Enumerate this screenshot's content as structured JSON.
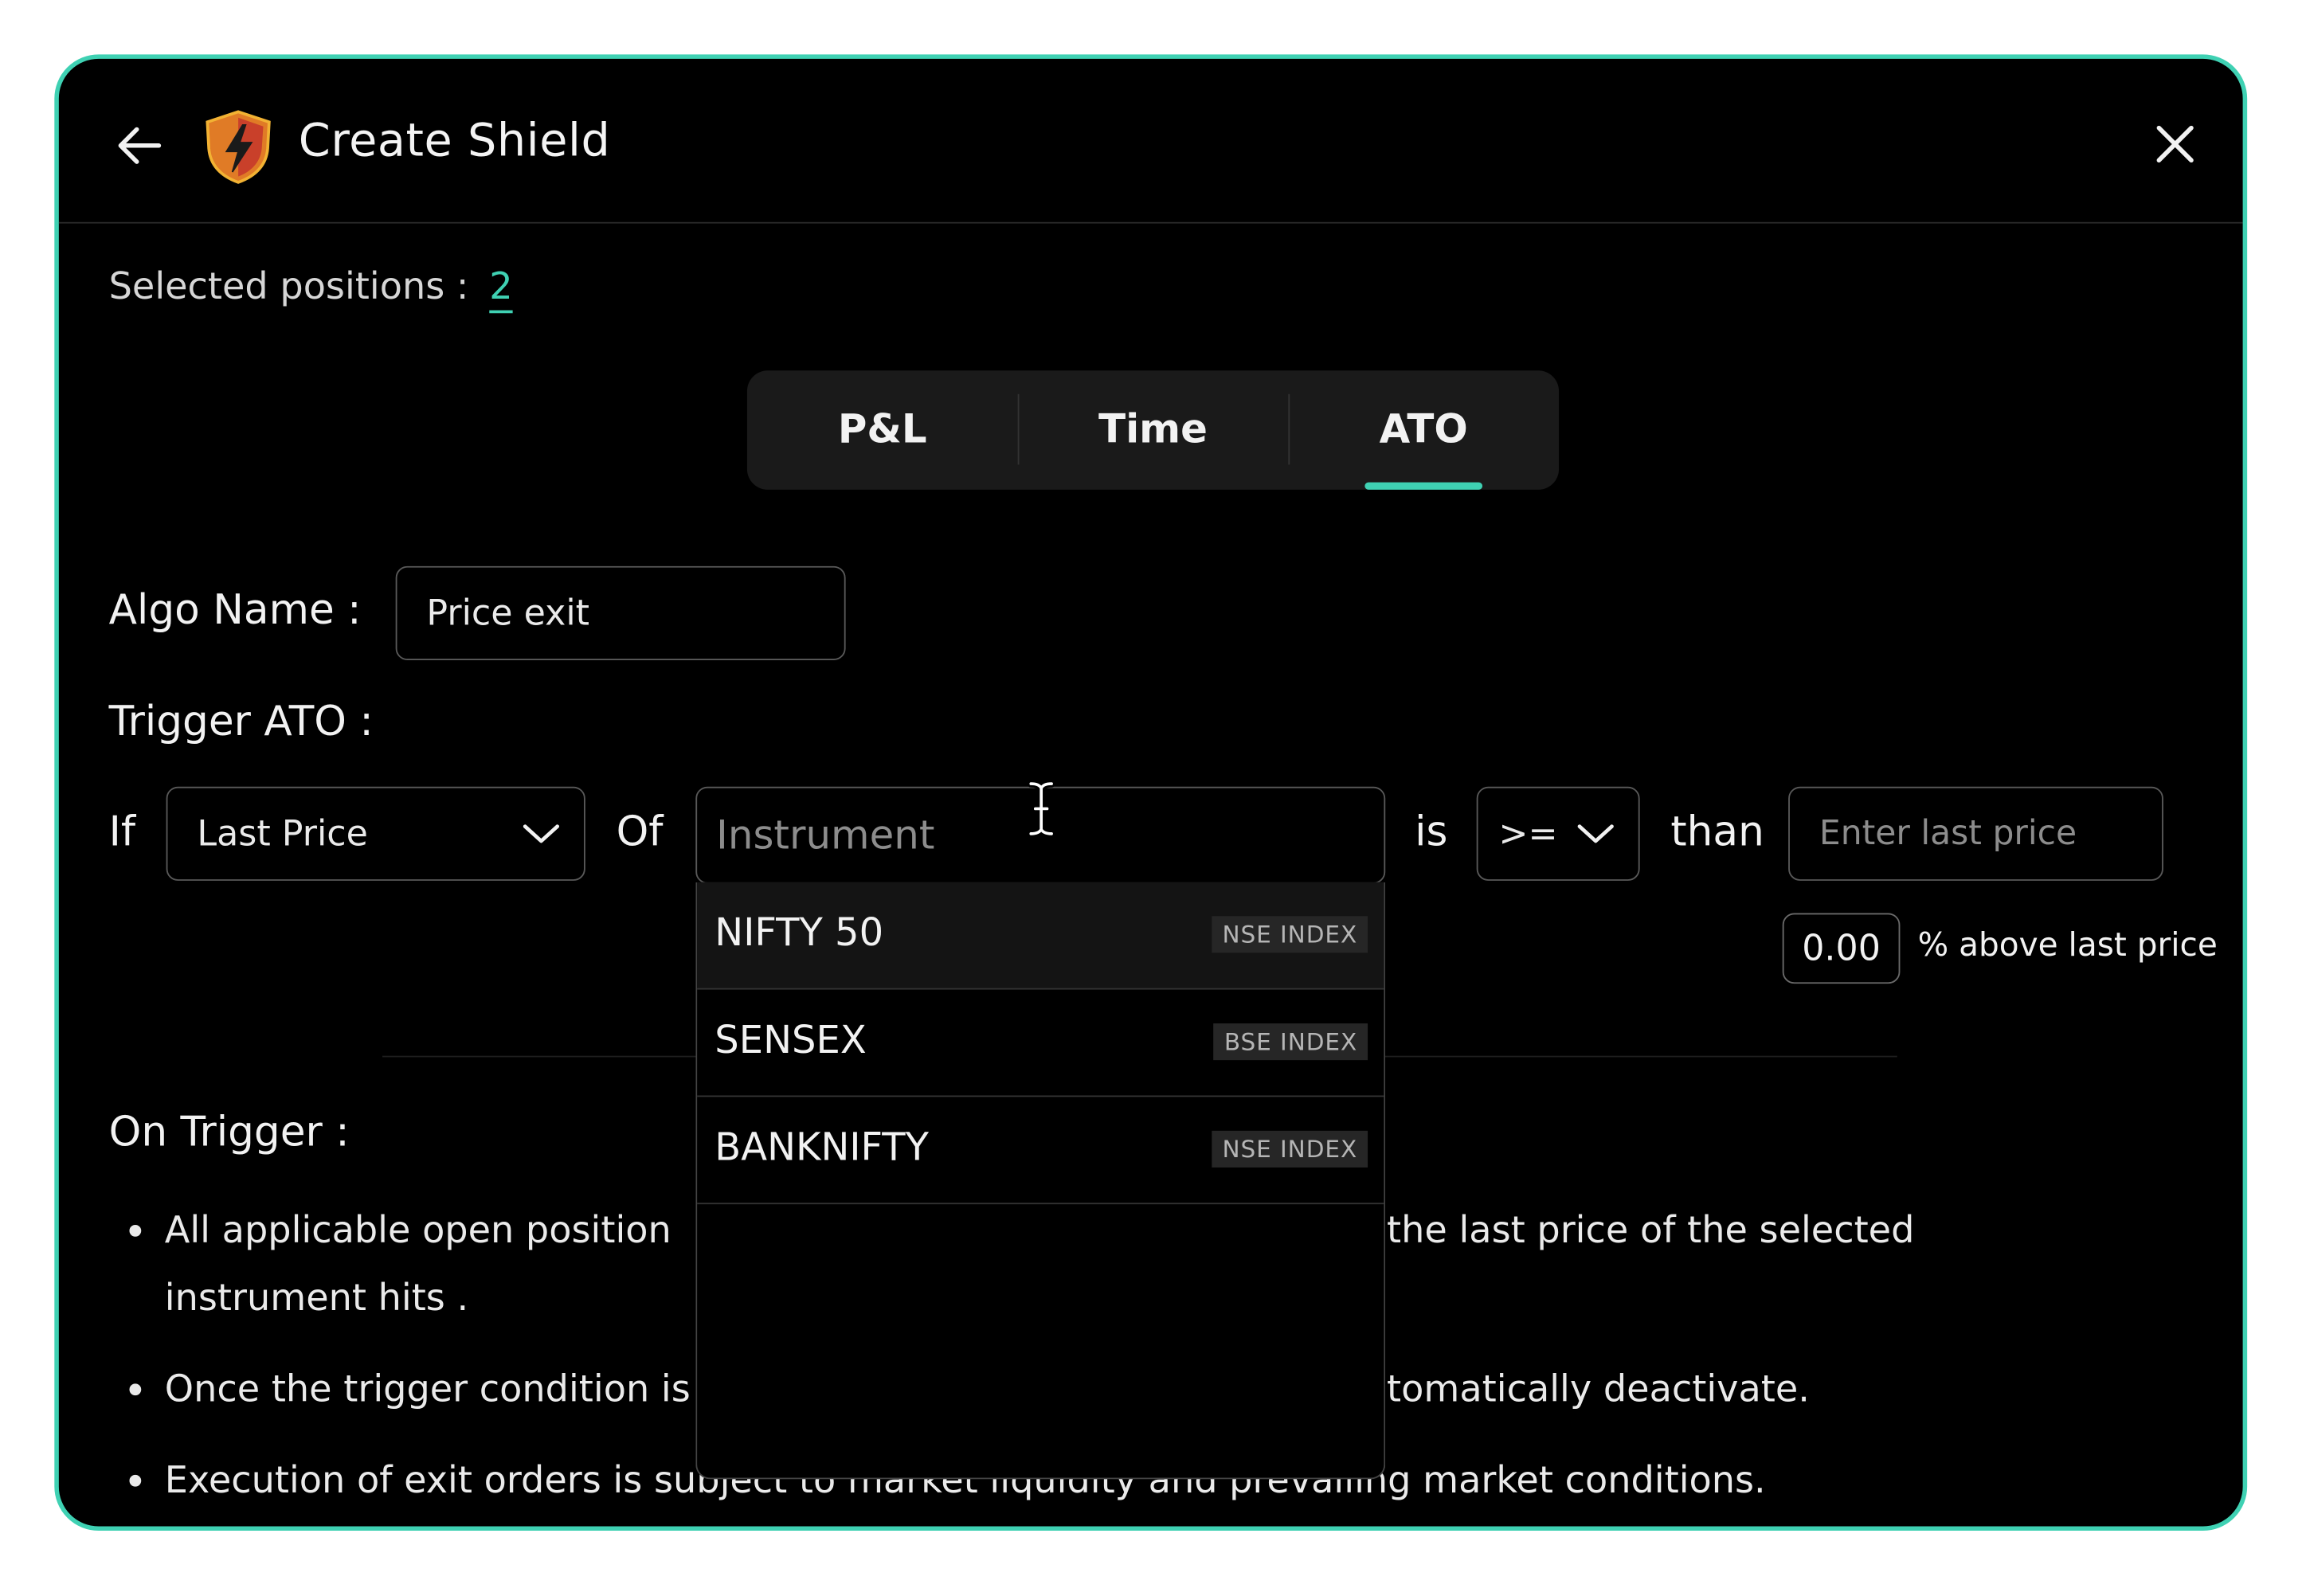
{
  "header": {
    "title": "Create Shield",
    "back_icon": "arrow-left-icon",
    "logo_icon": "shield-lightning-icon",
    "close_icon": "close-icon"
  },
  "selected": {
    "label": "Selected positions :",
    "count": "2"
  },
  "tabs": [
    {
      "label": "P&L",
      "active": false
    },
    {
      "label": "Time",
      "active": false
    },
    {
      "label": "ATO",
      "active": true
    }
  ],
  "algo": {
    "label": "Algo Name :",
    "value": "Price exit"
  },
  "trigger": {
    "label": "Trigger ATO :",
    "if_label": "If",
    "price_type": "Last Price",
    "of_label": "Of",
    "instrument_placeholder": "Instrument",
    "is_label": "is",
    "operator": ">=",
    "than_label": "than",
    "last_price_placeholder": "Enter last price",
    "pct_value": "0.00",
    "pct_label": "% above last price"
  },
  "dropdown": {
    "items": [
      {
        "name": "NIFTY 50",
        "badge": "NSE INDEX"
      },
      {
        "name": "SENSEX",
        "badge": "BSE INDEX"
      },
      {
        "name": "BANKNIFTY",
        "badge": "NSE INDEX"
      }
    ]
  },
  "on_trigger": {
    "label": "On Trigger :",
    "bullets": [
      {
        "left": "All applicable open position",
        "right": "the last price of the selected",
        "line2": "instrument hits ."
      },
      {
        "left": "Once the trigger condition is",
        "right": "tomatically deactivate."
      },
      {
        "text": "Execution of exit orders is subject to market liquidity and prevailing market conditions."
      }
    ]
  },
  "colors": {
    "accent": "#3fd1b3",
    "background": "#000000",
    "panel": "#1a1a1a"
  }
}
